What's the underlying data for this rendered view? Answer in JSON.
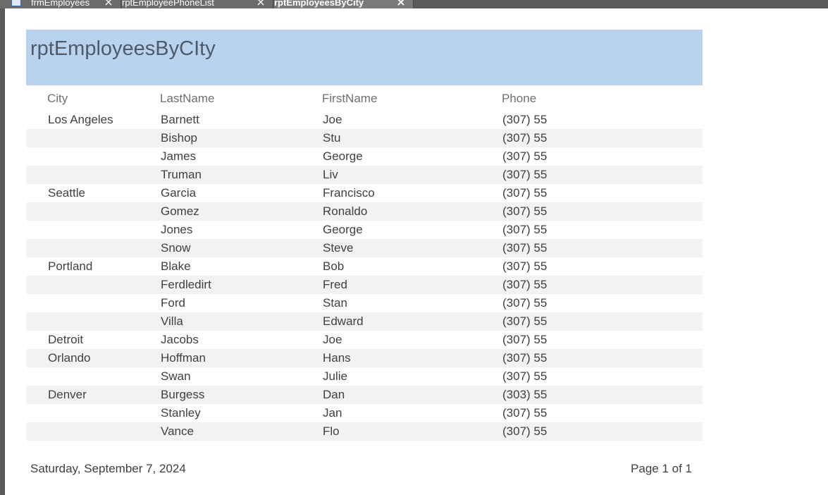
{
  "tabs": [
    {
      "label": "frmEmployees",
      "icon": "form-icon",
      "active": false
    },
    {
      "label": "rptEmployeePhoneList",
      "icon": "report-icon",
      "active": false
    },
    {
      "label": "rptEmployeesByCity",
      "icon": "report-icon",
      "active": true
    }
  ],
  "report": {
    "title": "rptEmployeesByCIty",
    "columns": {
      "city": "City",
      "last": "LastName",
      "first": "FirstName",
      "phone": "Phone"
    },
    "rows": [
      {
        "city": "Los Angeles",
        "last": "Barnett",
        "first": "Joe",
        "phone": "(307) 55"
      },
      {
        "city": "",
        "last": "Bishop",
        "first": "Stu",
        "phone": "(307) 55"
      },
      {
        "city": "",
        "last": "James",
        "first": "George",
        "phone": "(307) 55"
      },
      {
        "city": "",
        "last": "Truman",
        "first": "Liv",
        "phone": "(307) 55"
      },
      {
        "city": "Seattle",
        "last": "Garcia",
        "first": "Francisco",
        "phone": "(307) 55"
      },
      {
        "city": "",
        "last": "Gomez",
        "first": "Ronaldo",
        "phone": "(307) 55"
      },
      {
        "city": "",
        "last": "Jones",
        "first": "George",
        "phone": "(307) 55"
      },
      {
        "city": "",
        "last": "Snow",
        "first": "Steve",
        "phone": "(307) 55"
      },
      {
        "city": "Portland",
        "last": "Blake",
        "first": "Bob",
        "phone": "(307) 55"
      },
      {
        "city": "",
        "last": "Ferdledirt",
        "first": "Fred",
        "phone": "(307) 55"
      },
      {
        "city": "",
        "last": "Ford",
        "first": "Stan",
        "phone": "(307) 55"
      },
      {
        "city": "",
        "last": "Villa",
        "first": "Edward",
        "phone": "(307) 55"
      },
      {
        "city": "Detroit",
        "last": "Jacobs",
        "first": "Joe",
        "phone": "(307) 55"
      },
      {
        "city": "Orlando",
        "last": "Hoffman",
        "first": "Hans",
        "phone": "(307) 55"
      },
      {
        "city": "",
        "last": "Swan",
        "first": "Julie",
        "phone": "(307) 55"
      },
      {
        "city": "Denver",
        "last": "Burgess",
        "first": "Dan",
        "phone": "(303) 55"
      },
      {
        "city": "",
        "last": "Stanley",
        "first": "Jan",
        "phone": "(307) 55"
      },
      {
        "city": "",
        "last": "Vance",
        "first": "Flo",
        "phone": "(307) 55"
      }
    ],
    "footer": {
      "date": "Saturday, September 7, 2024",
      "page": "Page 1 of 1"
    }
  },
  "colors": {
    "header_band": "#b9d3ef",
    "alt_row": "#f2f2f2",
    "chrome": "#5a5a5a"
  }
}
